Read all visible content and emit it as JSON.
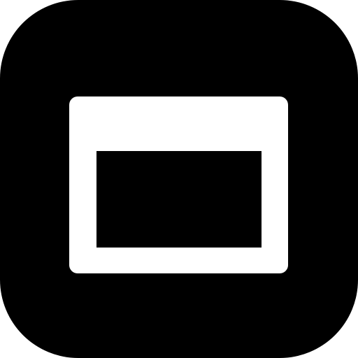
{
  "icon": {
    "name": "browser-window-icon",
    "tile_color": "#000000",
    "window_color": "#ffffff",
    "content_color": "#000000"
  }
}
